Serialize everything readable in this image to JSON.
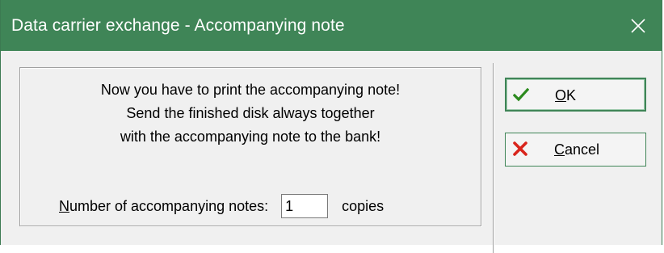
{
  "window": {
    "title": "Data carrier exchange - Accompanying note",
    "close_glyph": "✕"
  },
  "message": {
    "lines": [
      "Now you have to print the accompanying note!",
      "Send the finished disk always together",
      "with the accompanying note to the bank!"
    ]
  },
  "notes": {
    "label_accel": "N",
    "label_rest": "umber of accompanying notes:",
    "value": "1",
    "unit": "copies"
  },
  "buttons": {
    "ok": {
      "accel": "O",
      "rest": "K",
      "icon": "checkmark-icon",
      "icon_color": "#2c8a1e"
    },
    "cancel": {
      "accel": "C",
      "rest": "ancel",
      "icon": "x-icon",
      "icon_color": "#d9251c"
    }
  },
  "colors": {
    "titlebar": "#3f8557",
    "button_border": "#3f8557"
  }
}
